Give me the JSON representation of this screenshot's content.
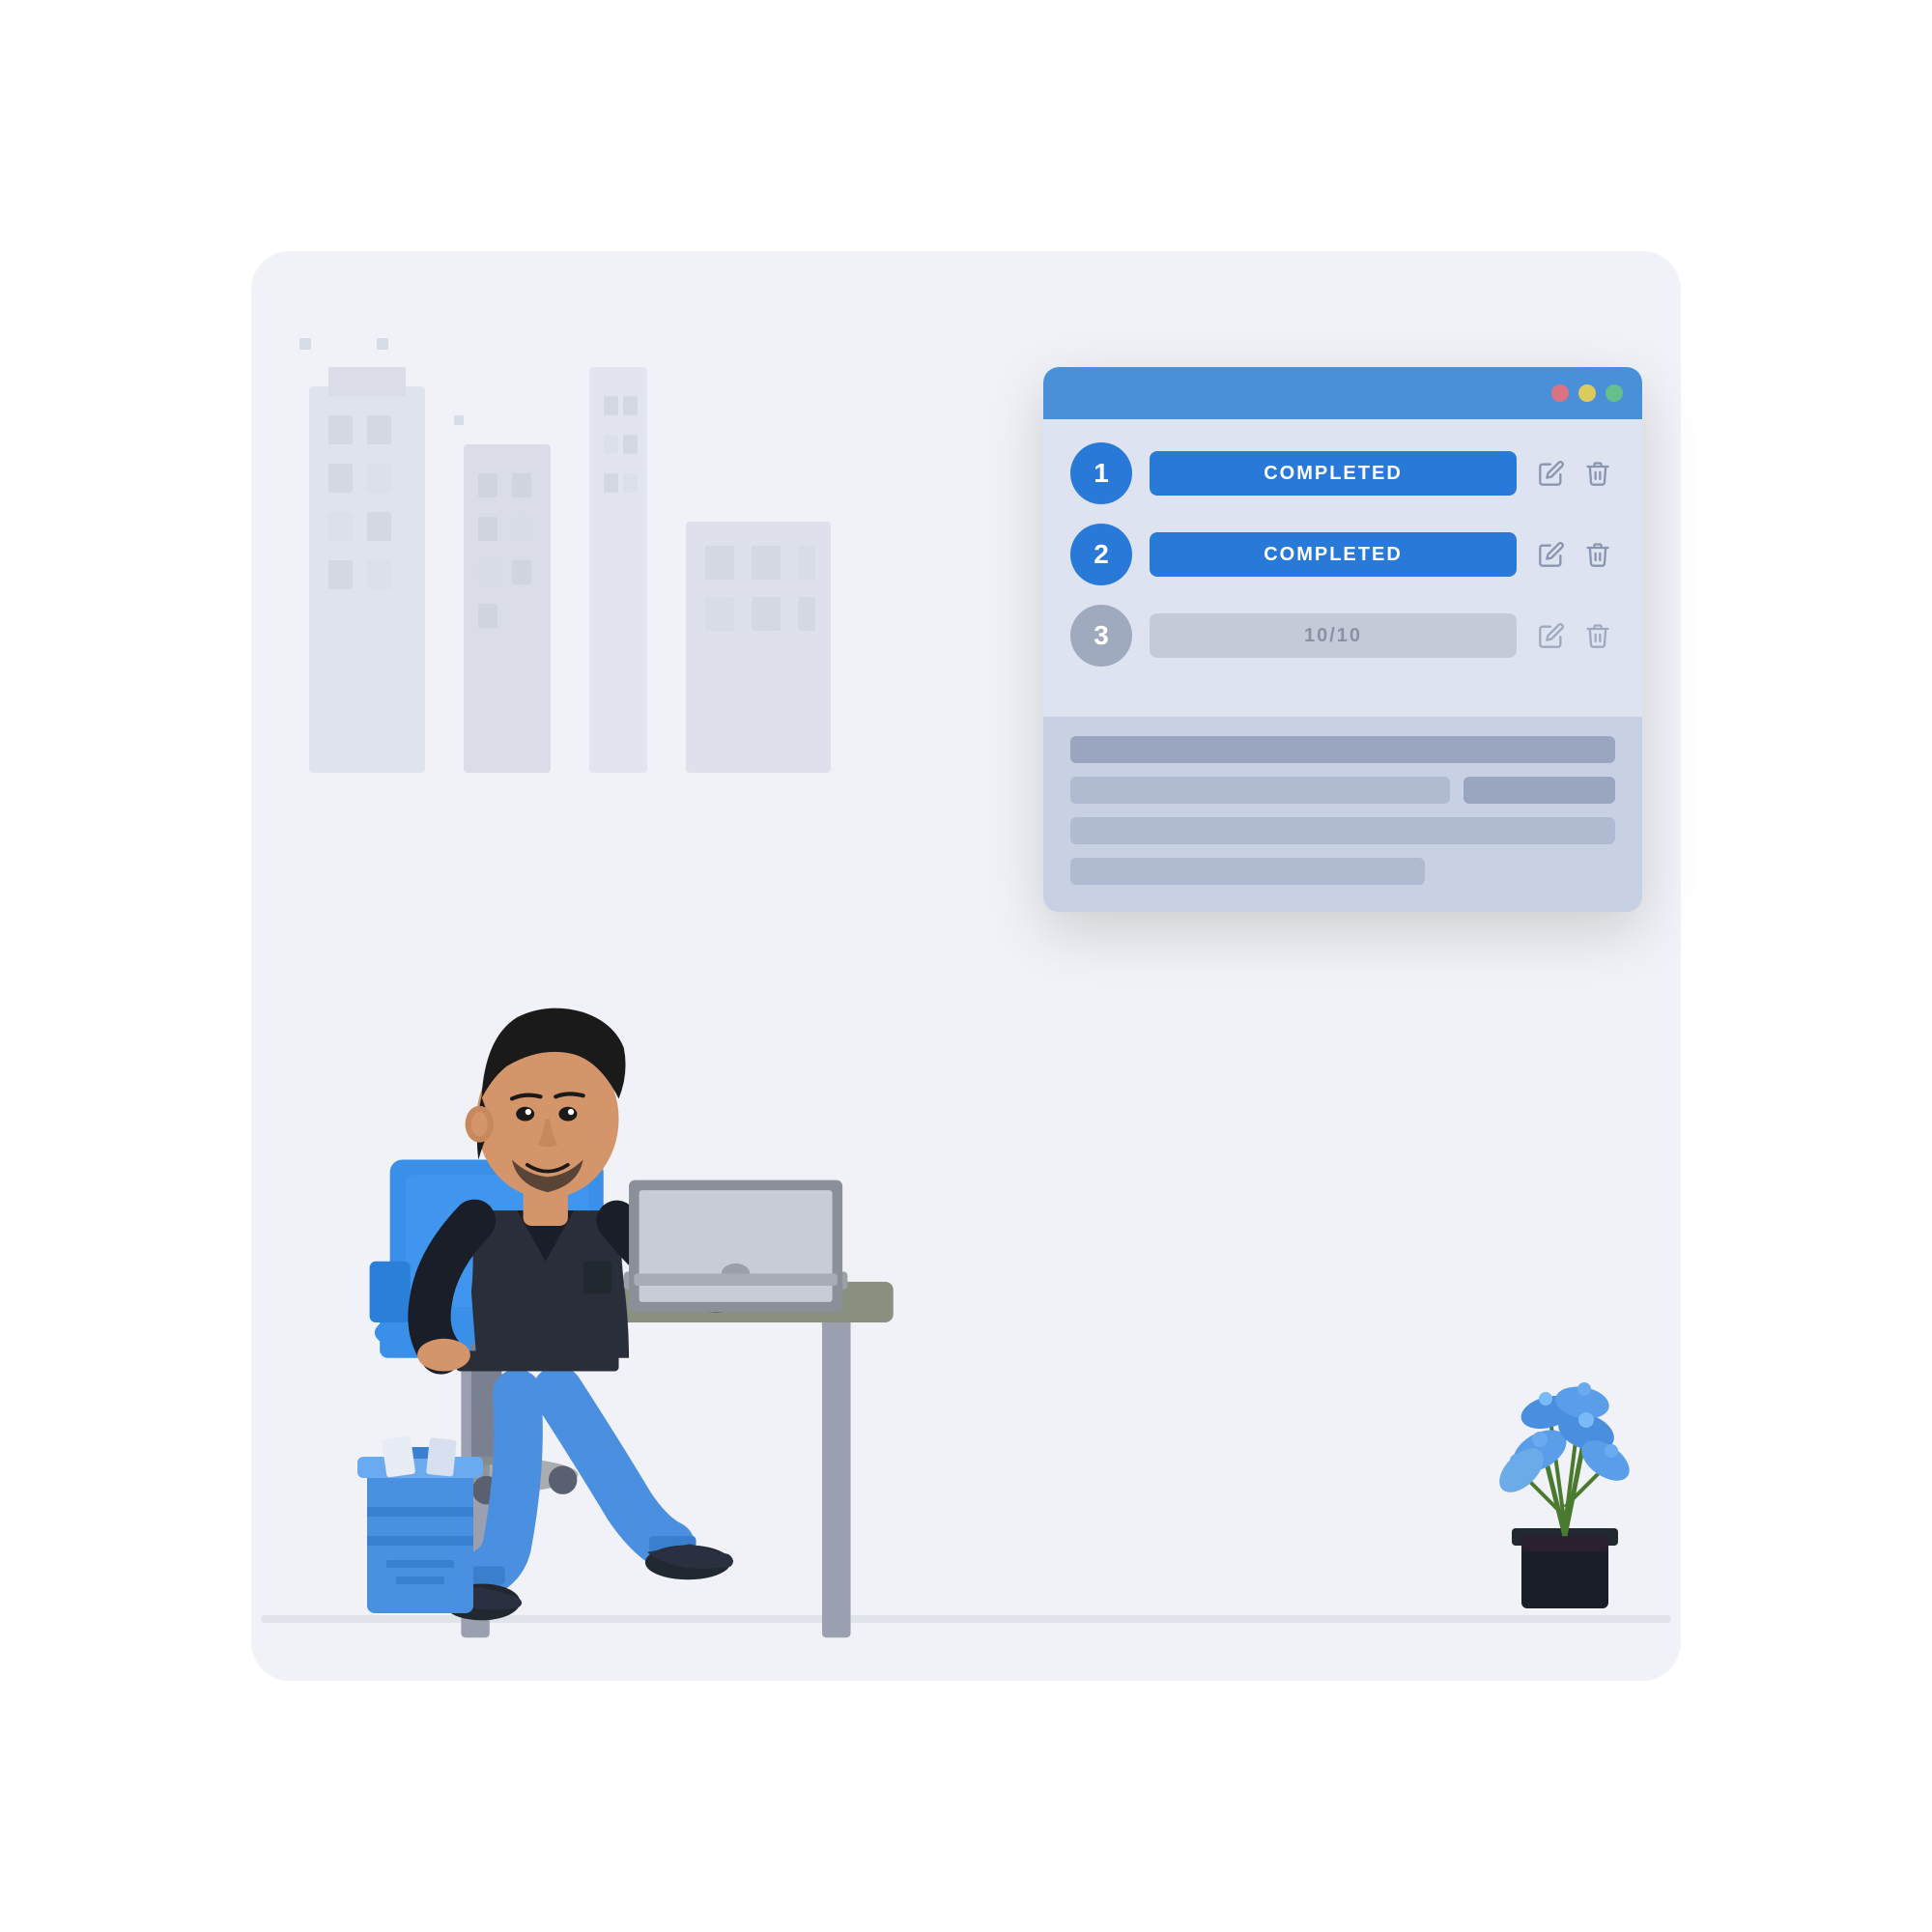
{
  "panel": {
    "titlebar": {
      "dots": [
        "red",
        "yellow",
        "green"
      ]
    },
    "tasks": [
      {
        "id": 1,
        "number": "1",
        "status": "COMPLETED",
        "status_type": "completed",
        "active": true
      },
      {
        "id": 2,
        "number": "2",
        "status": "COMPLETED",
        "status_type": "completed",
        "active": true
      },
      {
        "id": 3,
        "number": "3",
        "status": "10/10",
        "status_type": "progress",
        "active": false
      }
    ],
    "edit_icon": "✎",
    "delete_icon": "🗑"
  },
  "illustration": {
    "alt": "Person sitting at desk working on laptop"
  },
  "colors": {
    "blue_active": "#2979d9",
    "blue_panel_header": "#4a90d9",
    "blue_light": "#a8c4f0",
    "gray_inactive": "#a0aabf",
    "background": "#f0f2f7",
    "panel_bg": "#dde3f0"
  }
}
